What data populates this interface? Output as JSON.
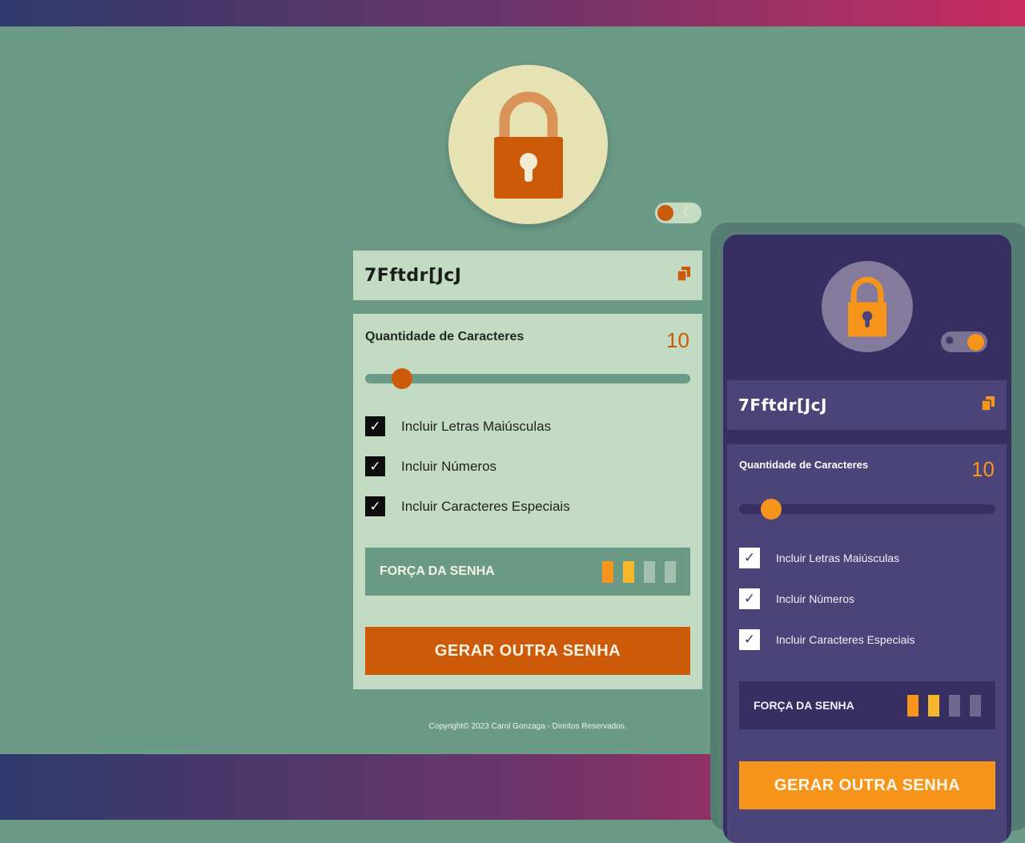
{
  "colors": {
    "light_accent": "#cd5a08",
    "light_background": "#6b9b86",
    "light_card": "#c2dbc2",
    "dark_accent": "#f6941c",
    "dark_background": "#372f62",
    "dark_card": "#4b4478",
    "strength_active_1": "#f6941c",
    "strength_active_2": "#f7b72c"
  },
  "light": {
    "password": "7Fftdr[JcJ",
    "copy_icon": "copy-icon",
    "lock_icon": "padlock-icon",
    "theme_toggle": {
      "mode_icon": "moon-icon",
      "state": "light"
    },
    "quantity_label": "Quantidade de Caracteres",
    "quantity_value": "10",
    "slider_value": 10,
    "options": [
      {
        "label": "Incluir Letras Maiúsculas",
        "checked": true
      },
      {
        "label": "Incluir Números",
        "checked": true
      },
      {
        "label": "Incluir Caracteres Especiais",
        "checked": true
      }
    ],
    "strength_label": "FORÇA DA SENHA",
    "strength_level": 2,
    "strength_total": 4,
    "generate_button": "GERAR OUTRA SENHA",
    "copyright": "Copyright© 2023 Carol Gonzaga - Direitos Reservados."
  },
  "dark": {
    "password": "7Fftdr[JcJ",
    "copy_icon": "copy-icon",
    "lock_icon": "padlock-icon",
    "theme_toggle": {
      "mode_icon": "sun-icon",
      "state": "dark"
    },
    "quantity_label": "Quantidade de Caracteres",
    "quantity_value": "10",
    "slider_value": 10,
    "options": [
      {
        "label": "Incluir Letras Maiúsculas",
        "checked": true
      },
      {
        "label": "Incluir Números",
        "checked": true
      },
      {
        "label": "Incluir Caracteres Especiais",
        "checked": true
      }
    ],
    "strength_label": "FORÇA DA SENHA",
    "strength_level": 2,
    "strength_total": 4,
    "generate_button": "GERAR OUTRA SENHA"
  }
}
